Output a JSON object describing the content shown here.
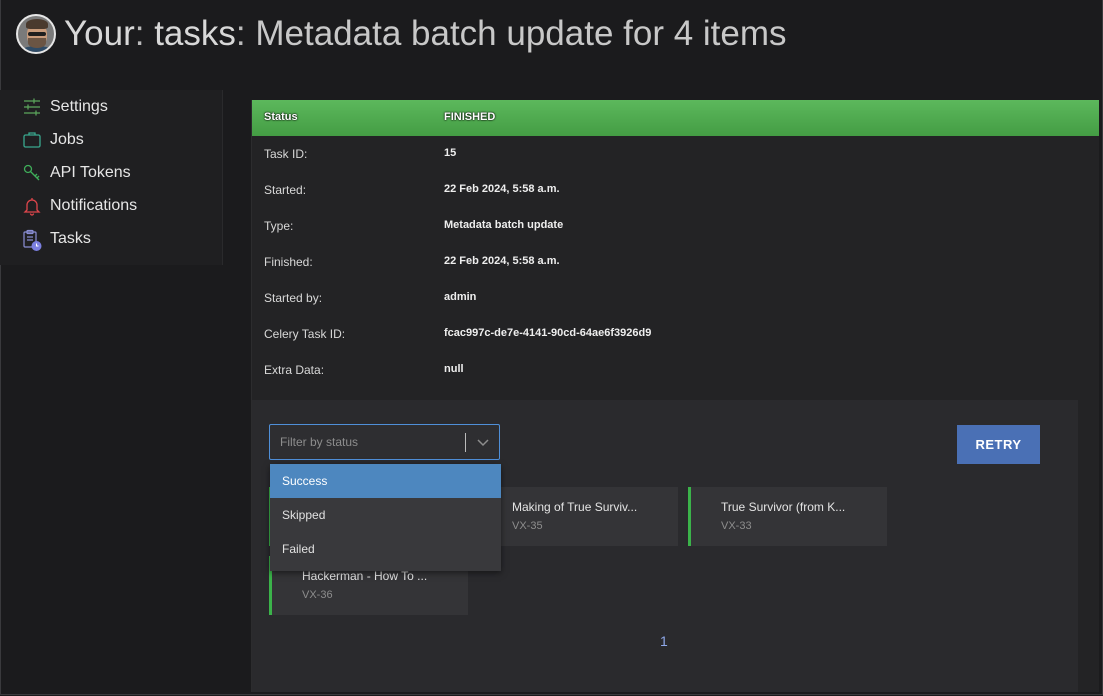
{
  "header": {
    "title_part1": "Your",
    "title_colon1": ":",
    "title_part2": "tasks",
    "title_colon2": ":",
    "title_part3": "Metadata batch update for 4 items"
  },
  "sidebar": {
    "items": [
      {
        "label": "Settings",
        "icon": "sliders-icon"
      },
      {
        "label": "Jobs",
        "icon": "briefcase-icon"
      },
      {
        "label": "API Tokens",
        "icon": "key-icon"
      },
      {
        "label": "Notifications",
        "icon": "bell-icon"
      },
      {
        "label": "Tasks",
        "icon": "clipboard-clock-icon"
      }
    ]
  },
  "task": {
    "status_label": "Status",
    "status_value": "FINISHED",
    "rows": [
      {
        "label": "Task ID:",
        "value": "15"
      },
      {
        "label": "Started:",
        "value": "22 Feb 2024, 5:58 a.m."
      },
      {
        "label": "Type:",
        "value": "Metadata batch update"
      },
      {
        "label": "Finished:",
        "value": "22 Feb 2024, 5:58 a.m."
      },
      {
        "label": "Started by:",
        "value": "admin"
      },
      {
        "label": "Celery Task ID:",
        "value": "fcac997c-de7e-4141-90cd-64ae6f3926d9"
      },
      {
        "label": "Extra Data:",
        "value": "null"
      }
    ]
  },
  "filter": {
    "placeholder": "Filter by status",
    "options": [
      "Success",
      "Skipped",
      "Failed"
    ],
    "highlighted": "Success"
  },
  "retry_label": "RETRY",
  "items": [
    {
      "name": "Making of True Surviv...",
      "id": "VX-35"
    },
    {
      "name": "True Survivor (from K...",
      "id": "VX-33"
    },
    {
      "name": "Hackerman - How To ...",
      "id": "VX-36"
    }
  ],
  "pagination": {
    "current": "1"
  },
  "colors": {
    "status_green": "#5cb85c",
    "retry_blue": "#4a70b5",
    "item_border_green": "#3bb34a",
    "dropdown_highlight": "#4d87bf"
  }
}
